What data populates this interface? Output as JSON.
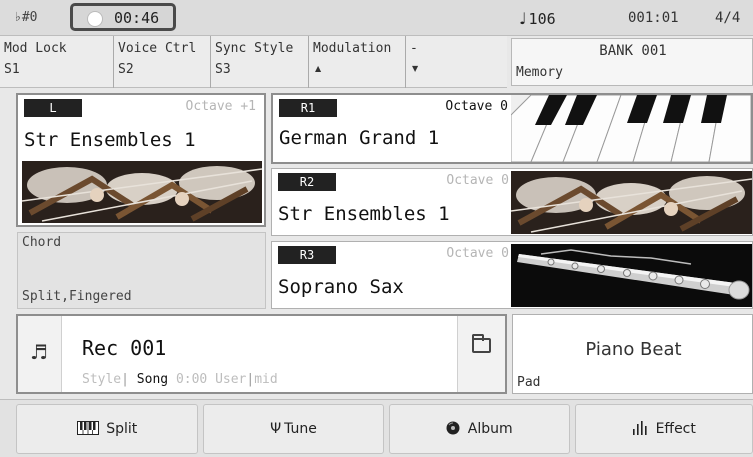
{
  "status": {
    "transpose": "♭#0",
    "record_time": "00:46",
    "tempo_symbol": "♩",
    "tempo": "106",
    "measure": "001:01",
    "time_signature": "4/4"
  },
  "assign": [
    {
      "name": "Mod Lock",
      "value": "S1"
    },
    {
      "name": "Voice Ctrl",
      "value": "S2"
    },
    {
      "name": "Sync Style",
      "value": "S3"
    },
    {
      "name": "Modulation",
      "value": "▲"
    },
    {
      "name": "-",
      "value": "▼"
    }
  ],
  "memory": {
    "bank": "BANK 001",
    "label": "Memory"
  },
  "voices": {
    "left": {
      "tag": "L",
      "octave": "Octave +1",
      "name": "Str Ensembles 1",
      "image": "violin-section-photo"
    },
    "r1": {
      "tag": "R1",
      "octave": "Octave 0",
      "name": "German Grand 1",
      "image": "piano-keys-photo"
    },
    "r2": {
      "tag": "R2",
      "octave": "Octave 0",
      "name": "Str Ensembles 1",
      "image": "violin-section-photo"
    },
    "r3": {
      "tag": "R3",
      "octave": "Octave 0",
      "name": "Soprano Sax",
      "image": "soprano-sax-photo"
    }
  },
  "chord": {
    "label": "Chord",
    "value": "Split,Fingered"
  },
  "song": {
    "icon": "music-note-icon",
    "name": "Rec 001",
    "mode_style": "Style",
    "mode_song": "Song",
    "time": "0:00",
    "mode_user": "User",
    "mode_mid": "mid",
    "separator": "|"
  },
  "pad": {
    "title": "Piano Beat",
    "label": "Pad"
  },
  "buttons": [
    {
      "icon": "keyboard-icon",
      "label": "Split"
    },
    {
      "icon": "tuning-fork-icon",
      "label": "Tune"
    },
    {
      "icon": "disc-icon",
      "label": "Album"
    },
    {
      "icon": "equalizer-icon",
      "label": "Effect"
    }
  ],
  "colors": {
    "tag_bg": "#222222",
    "active_text": "#111111",
    "inactive_text": "#b5b5b5",
    "panel_border": "#8e8e8e"
  }
}
